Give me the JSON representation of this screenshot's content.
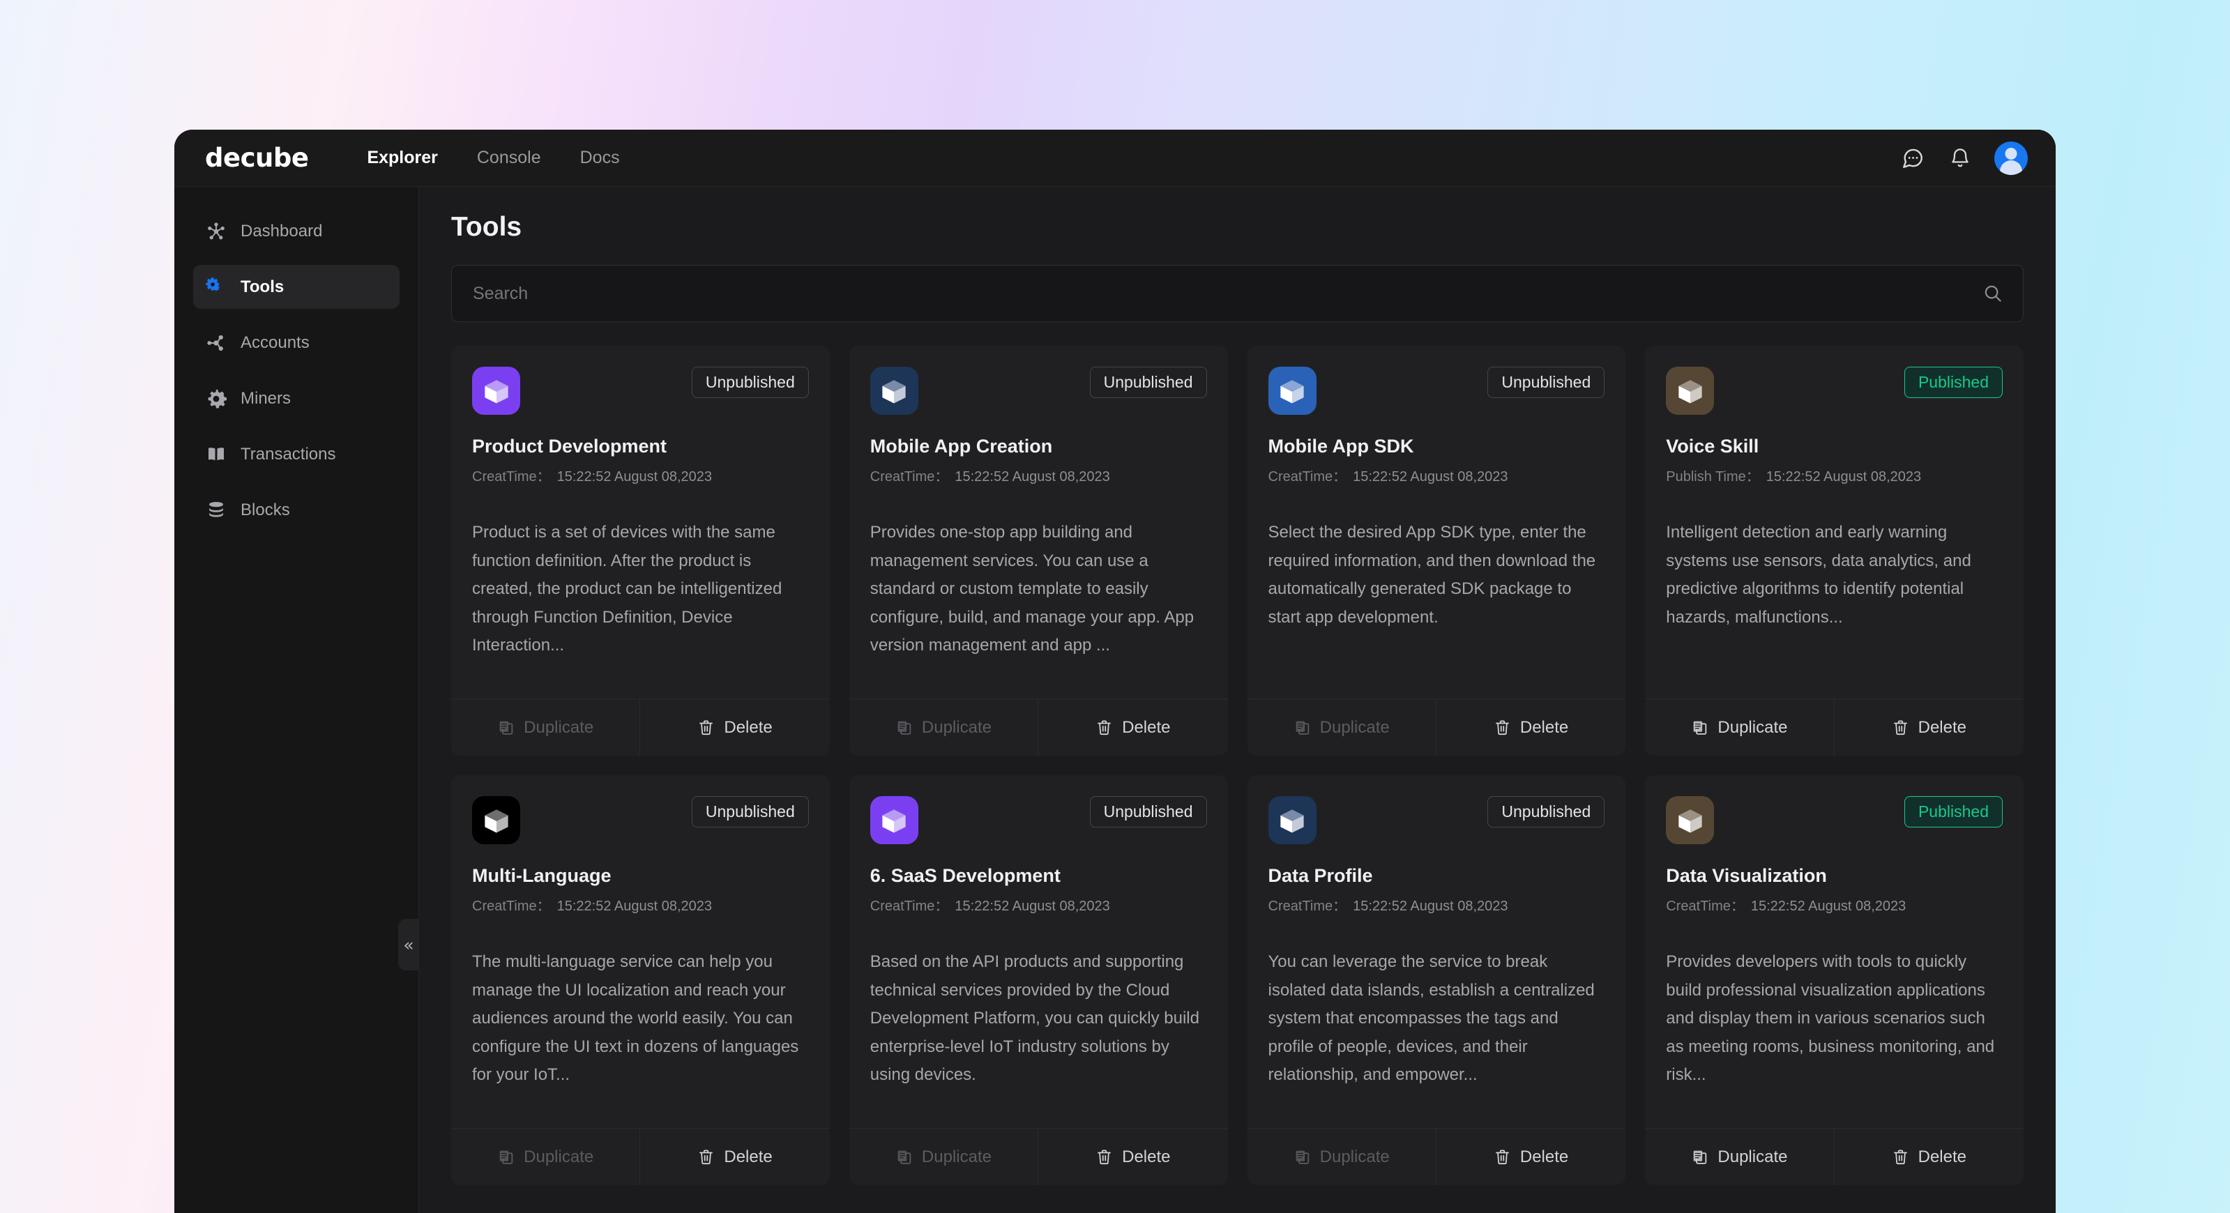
{
  "header": {
    "brand": "decube",
    "nav": [
      {
        "label": "Explorer",
        "active": true
      },
      {
        "label": "Console",
        "active": false
      },
      {
        "label": "Docs",
        "active": false
      }
    ],
    "icons": {
      "chat": "chat-bubble-icon",
      "bell": "notification-bell-icon",
      "avatar": "user-avatar"
    }
  },
  "sidebar": {
    "collapse_label": "«",
    "items": [
      {
        "label": "Dashboard",
        "icon": "hub-icon",
        "active": false
      },
      {
        "label": "Tools",
        "icon": "gears-icon",
        "active": true
      },
      {
        "label": "Accounts",
        "icon": "share-nodes-icon",
        "active": false
      },
      {
        "label": "Miners",
        "icon": "gear-icon",
        "active": false
      },
      {
        "label": "Transactions",
        "icon": "book-icon",
        "active": false
      },
      {
        "label": "Blocks",
        "icon": "database-stack-icon",
        "active": false
      }
    ]
  },
  "main": {
    "title": "Tools",
    "search": {
      "value": "",
      "placeholder": "Search",
      "icon": "search-icon"
    },
    "footer_actions": {
      "duplicate": "Duplicate",
      "delete": "Delete"
    },
    "status_labels": {
      "published": "Published",
      "unpublished": "Unpublished"
    },
    "cards": [
      {
        "name": "Product Development",
        "status": "Unpublished",
        "meta_label": "CreatTime：",
        "meta_value": "15:22:52 August 08,2023",
        "description": "Product is a set of devices with the same function definition. After the product is created, the product can be intelligentized through Function Definition, Device Interaction...",
        "icon_bg": "#7b3ff2",
        "cube_top": "#b89bf7",
        "cube_left": "#ffffff",
        "cube_right": "#d6c6fb",
        "duplicate_enabled": false
      },
      {
        "name": "Mobile App Creation",
        "status": "Unpublished",
        "meta_label": "CreatTime：",
        "meta_value": "15:22:52 August 08,2023",
        "description": "Provides one-stop app building and management services. You can use a standard or custom template to easily configure, build, and manage your app. App version management and app ...",
        "icon_bg": "#1d3557",
        "cube_top": "#7a8aa8",
        "cube_left": "#ffffff",
        "cube_right": "#c3cbd9",
        "duplicate_enabled": false
      },
      {
        "name": "Mobile App SDK",
        "status": "Unpublished",
        "meta_label": "CreatTime：",
        "meta_value": "15:22:52 August 08,2023",
        "description": "Select the desired App SDK type, enter the required information, and then download the automatically generated SDK package to start app development.",
        "icon_bg": "#2a62b8",
        "cube_top": "#8ca6d6",
        "cube_left": "#ffffff",
        "cube_right": "#c6d4ea",
        "duplicate_enabled": false
      },
      {
        "name": "Voice Skill",
        "status": "Published",
        "meta_label": "Publish Time：",
        "meta_value": "15:22:52 August 08,2023",
        "description": "Intelligent detection and early warning systems use sensors, data analytics, and predictive algorithms to identify potential hazards, malfunctions...",
        "icon_bg": "#564734",
        "cube_top": "#9b9285",
        "cube_left": "#ffffff",
        "cube_right": "#cfcbc4",
        "duplicate_enabled": true
      },
      {
        "name": "Multi-Language",
        "status": "Unpublished",
        "meta_label": "CreatTime：",
        "meta_value": "15:22:52 August 08,2023",
        "description": "The multi-language service can help you manage the UI localization and reach your audiences around the world easily. You can configure the UI text in dozens of languages for your IoT...",
        "icon_bg": "#000000",
        "cube_top": "#6e6e6e",
        "cube_left": "#ffffff",
        "cube_right": "#b7b7b7",
        "duplicate_enabled": false
      },
      {
        "name": "6. SaaS Development",
        "status": "Unpublished",
        "meta_label": "CreatTime：",
        "meta_value": "15:22:52 August 08,2023",
        "description": "Based on the API products and supporting technical services provided by the Cloud Development Platform, you can quickly build enterprise-level IoT industry solutions by using devices.",
        "icon_bg": "#7b3ff2",
        "cube_top": "#b89bf7",
        "cube_left": "#ffffff",
        "cube_right": "#d6c6fb",
        "duplicate_enabled": false
      },
      {
        "name": "Data Profile",
        "status": "Unpublished",
        "meta_label": "CreatTime：",
        "meta_value": "15:22:52 August 08,2023",
        "description": "You can leverage the service to break isolated data islands, establish a centralized system that encompasses the tags and profile of people, devices, and their relationship, and empower...",
        "icon_bg": "#1d3557",
        "cube_top": "#7a8aa8",
        "cube_left": "#ffffff",
        "cube_right": "#c3cbd9",
        "duplicate_enabled": false
      },
      {
        "name": "Data Visualization",
        "status": "Published",
        "meta_label": "CreatTime：",
        "meta_value": "15:22:52 August 08,2023",
        "description": "Provides developers with tools to quickly build professional visualization applications and display them in various scenarios such as meeting rooms, business monitoring, and risk...",
        "icon_bg": "#564734",
        "cube_top": "#9b9285",
        "cube_left": "#ffffff",
        "cube_right": "#cfcbc4",
        "duplicate_enabled": true
      }
    ]
  }
}
